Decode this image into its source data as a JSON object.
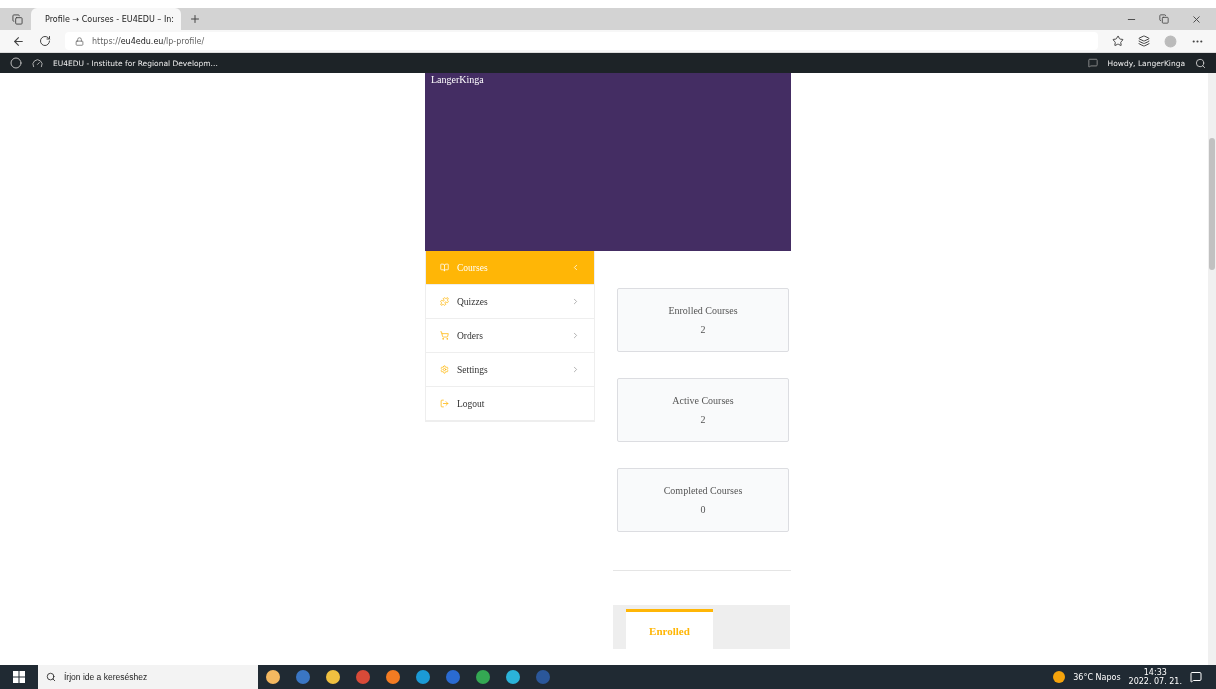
{
  "browser": {
    "tab_title": "Profile → Courses - EU4EDU – In:",
    "url_prefix": "https://",
    "url_host": "eu4edu.eu",
    "url_path": "/lp-profile/"
  },
  "admin_bar": {
    "site": "EU4EDU - Institute for Regional Developm...",
    "greeting": "Howdy, LangerKinga"
  },
  "profile": {
    "name": "LangerKinga"
  },
  "menu": [
    {
      "kind": "courses",
      "label": "Courses",
      "selected": true,
      "arrow": true
    },
    {
      "kind": "quizzes",
      "label": "Quizzes",
      "selected": false,
      "arrow": true
    },
    {
      "kind": "orders",
      "label": "Orders",
      "selected": false,
      "arrow": true
    },
    {
      "kind": "settings",
      "label": "Settings",
      "selected": false,
      "arrow": true
    },
    {
      "kind": "logout",
      "label": "Logout",
      "selected": false,
      "arrow": false
    }
  ],
  "stats": [
    {
      "label": "Enrolled Courses",
      "value": "2"
    },
    {
      "label": "Active Courses",
      "value": "2"
    },
    {
      "label": "Completed Courses",
      "value": "0"
    }
  ],
  "course_tabs": [
    {
      "label": "Enrolled",
      "selected": true
    }
  ],
  "taskbar": {
    "search_placeholder": "Írjon ide a kereséshez",
    "weather": "36°C  Napos",
    "time": "14:33",
    "date": "2022. 07. 21."
  }
}
